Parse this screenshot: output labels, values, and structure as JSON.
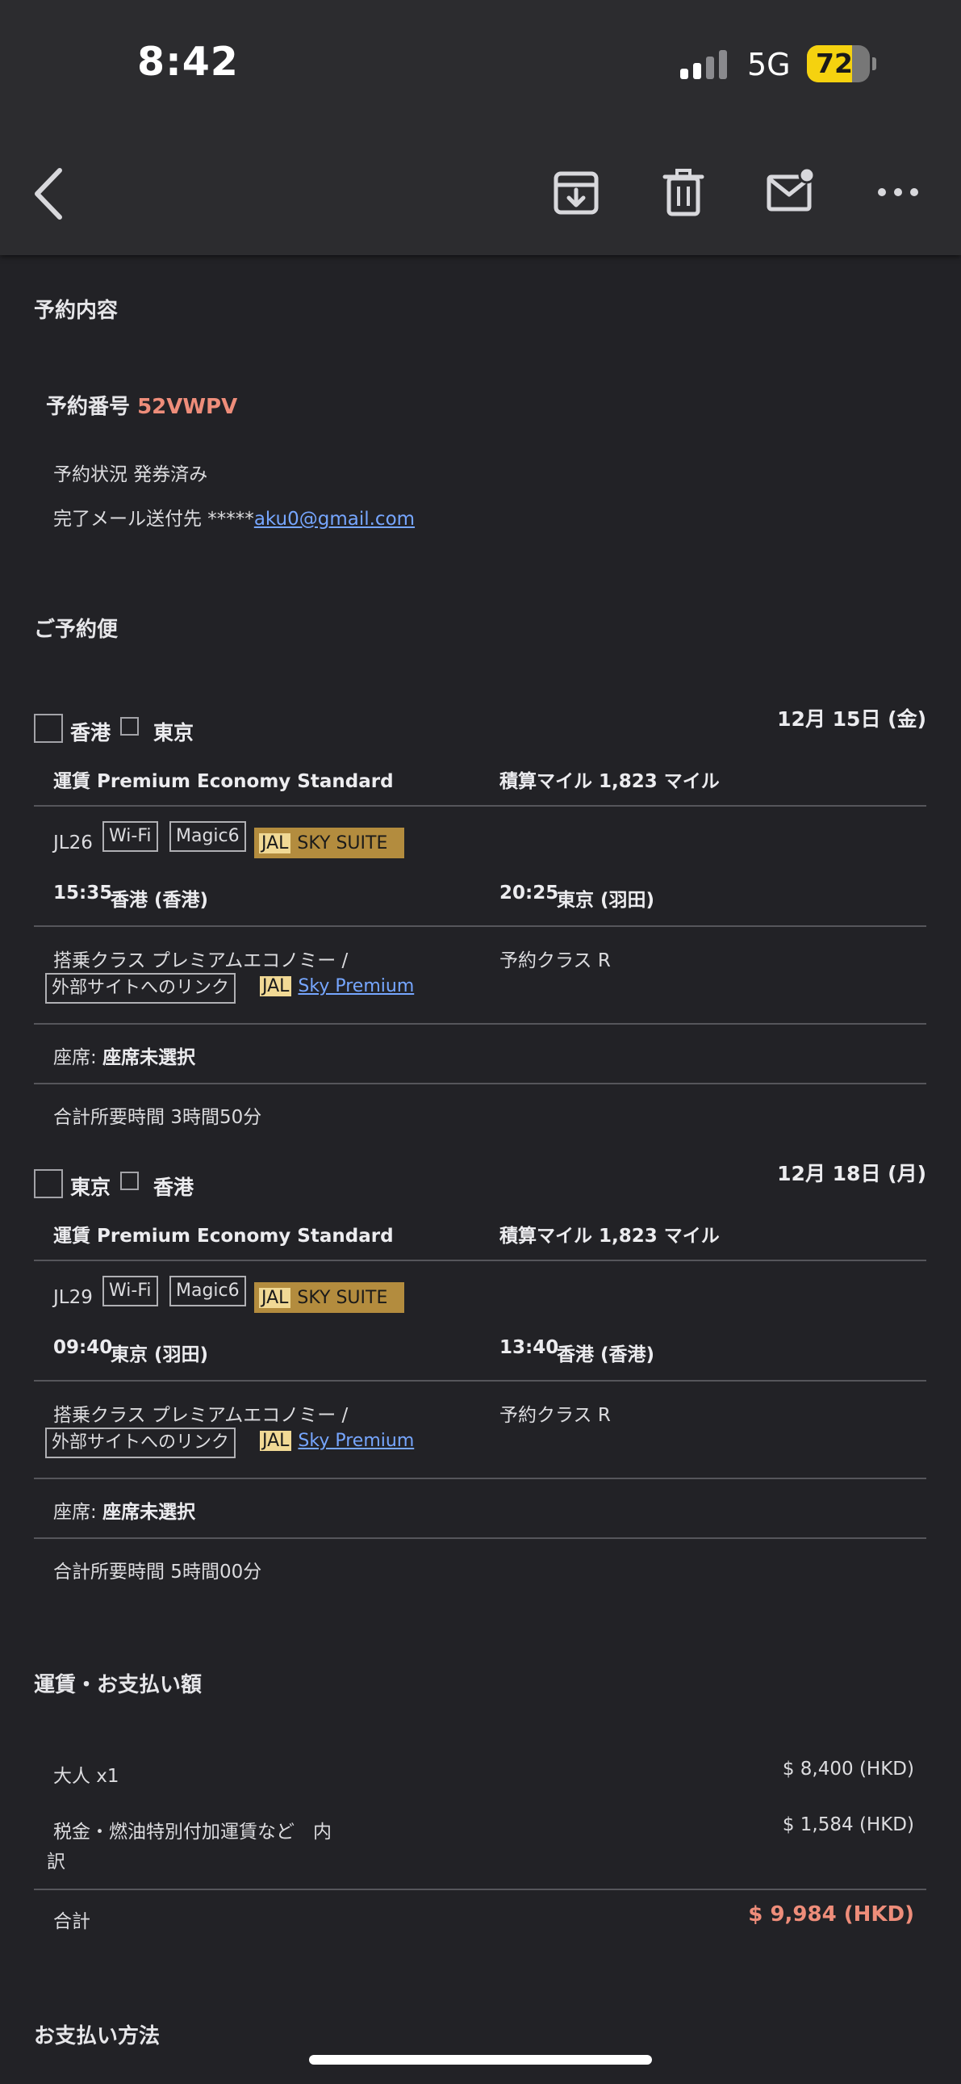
{
  "status_bar": {
    "time": "8:42",
    "network": "5G",
    "battery": 72
  },
  "toolbar": {
    "back_icon": "chevron-left-icon",
    "archive_icon": "archive-icon",
    "delete_icon": "trash-icon",
    "mark_unread_icon": "mail-unread-icon",
    "more_icon": "more-horizontal-icon"
  },
  "reservation": {
    "section_title": "予約内容",
    "number_label": "予約番号",
    "number": "52VWPV",
    "status": "予約状況 発券済み",
    "mail_label": "完了メール送付先 *****",
    "mail_link": "aku0@gmail.com"
  },
  "flights_title": "ご予約便",
  "flights": [
    {
      "from": "香港",
      "to": "東京",
      "date": "12月 15日 (金)",
      "fare": "運賃 Premium Economy Standard",
      "miles": "積算マイル 1,823 マイル",
      "flight_no": "JL26",
      "tags": [
        "Wi-Fi",
        "Magic6"
      ],
      "suite_jal": "JAL",
      "suite_text": "SKY SUITE",
      "dep_time": "15:35",
      "dep_place": "香港 (香港)",
      "arr_time": "20:25",
      "arr_place": "東京 (羽田)",
      "cabin": "搭乗クラス プレミアムエコノミー /",
      "ext_link": "外部サイトへのリンク",
      "premium_jal": "JAL",
      "premium_link": "Sky Premium",
      "booking_class": "予約クラス R",
      "seat_label": "座席:",
      "seat_value": "座席未選択",
      "duration": "合計所要時間 3時間50分"
    },
    {
      "from": "東京",
      "to": "香港",
      "date": "12月 18日 (月)",
      "fare": "運賃 Premium Economy Standard",
      "miles": "積算マイル 1,823 マイル",
      "flight_no": "JL29",
      "tags": [
        "Wi-Fi",
        "Magic6"
      ],
      "suite_jal": "JAL",
      "suite_text": "SKY SUITE",
      "dep_time": "09:40",
      "dep_place": "東京 (羽田)",
      "arr_time": "13:40",
      "arr_place": "香港 (香港)",
      "cabin": "搭乗クラス プレミアムエコノミー /",
      "ext_link": "外部サイトへのリンク",
      "premium_jal": "JAL",
      "premium_link": "Sky Premium",
      "booking_class": "予約クラス R",
      "seat_label": "座席:",
      "seat_value": "座席未選択",
      "duration": "合計所要時間 5時間00分"
    }
  ],
  "payment": {
    "title": "運賃・お支払い額",
    "adult_label": "大人 x1",
    "adult_price": "$ 8,400 (HKD)",
    "tax_label_1": "税金・燃油特別付加運賃など　内",
    "tax_label_2": "訳",
    "tax_price": "$ 1,584 (HKD)",
    "total_label": "合計",
    "total_price": "$ 9,984 (HKD)"
  },
  "payment_method_title": "お支払い方法"
}
